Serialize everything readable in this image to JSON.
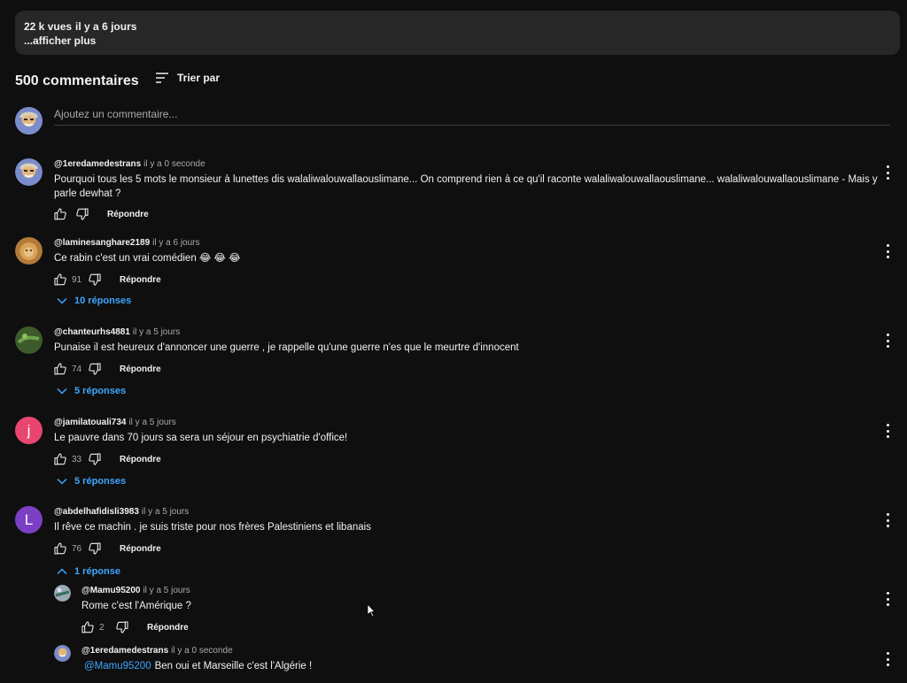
{
  "description": {
    "views": "22 k vues",
    "date": "il y a 6 jours",
    "more": "...afficher plus"
  },
  "comments_header": {
    "count": "500 commentaires",
    "sort_label": "Trier par",
    "add_placeholder": "Ajoutez un commentaire..."
  },
  "comments": [
    {
      "author": "@1eredamedestrans",
      "time": "il y a 0 seconde",
      "text": "Pourquoi tous les 5 mots le monsieur à lunettes dis walaliwalouwallaouslimane... On comprend rien à ce qu'il raconte walaliwalouwallaouslimane... walaliwalouwallaouslimane - Mais y parle dewhat ?",
      "likes": "",
      "reply_label": "Répondre"
    },
    {
      "author": "@laminesanghare2189",
      "time": "il y a 6 jours",
      "text": "Ce rabin c'est un vrai comédien 😂 😂 😂",
      "likes": "91",
      "reply_label": "Répondre",
      "replies_label": "10 réponses"
    },
    {
      "author": "@chanteurhs4881",
      "time": "il y a 5 jours",
      "text": "Punaise il est heureux d'annoncer une guerre , je rappelle qu'une guerre n'es que le meurtre d'innocent",
      "likes": "74",
      "reply_label": "Répondre",
      "replies_label": "5 réponses"
    },
    {
      "author": "@jamilatouali734",
      "time": "il y a 5 jours",
      "text": "Le pauvre dans 70 jours sa sera un séjour en psychiatrie d'office!",
      "likes": "33",
      "reply_label": "Répondre",
      "replies_label": "5 réponses",
      "avatar_letter": "j"
    },
    {
      "author": "@abdelhafidisli3983",
      "time": "il y a 5 jours",
      "text": "Il rêve ce machin  . je suis triste pour nos frères Palestiniens et libanais",
      "likes": "76",
      "reply_label": "Répondre",
      "replies_label": "1 réponse",
      "avatar_letter": "L"
    }
  ],
  "replies": [
    {
      "author": "@Mamu95200",
      "time": "il y a 5 jours",
      "text": "Rome c'est l'Amérique ?",
      "likes": "2",
      "reply_label": "Répondre"
    },
    {
      "author": "@1eredamedestrans",
      "time": "il y a 0 seconde",
      "mention": "@Mamu95200",
      "text": "Ben oui et Marseille c'est l'Algérie !"
    }
  ],
  "icons": {
    "sort": "sort-icon",
    "like": "thumb-up-icon",
    "dislike": "thumb-down-icon",
    "more": "more-vert-icon",
    "expand": "chevron-down-icon",
    "collapse": "chevron-up-icon"
  },
  "colors": {
    "background": "#0f0f0f",
    "link": "#3ea6ff",
    "avatar_j": "#e8456f",
    "avatar_l": "#7b3fc4"
  }
}
